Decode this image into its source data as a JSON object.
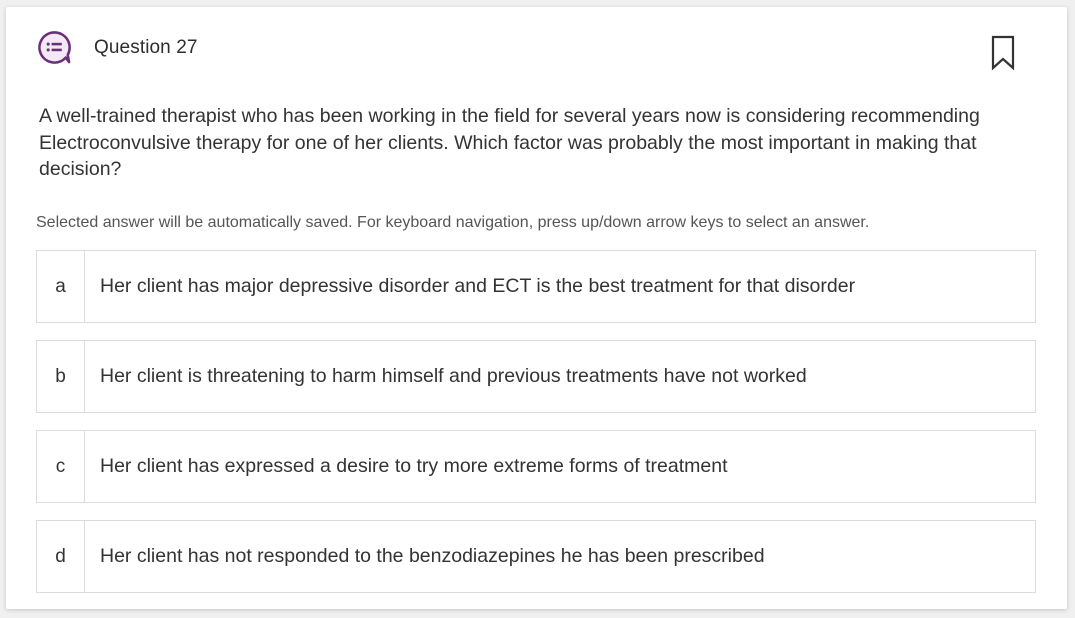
{
  "question": {
    "title": "Question 27",
    "text": "A well-trained therapist who has been working in the field for several years now is considering recommending Electroconvulsive therapy for one of her clients. Which factor was probably the most important in making that decision?",
    "icon": "question-list-icon",
    "bookmark_icon": "bookmark-icon"
  },
  "instructions": "Selected answer will be automatically saved. For keyboard navigation, press up/down arrow keys to select an answer.",
  "answers": [
    {
      "letter": "a",
      "text": "Her client has major depressive disorder and ECT is the best treatment for that disorder"
    },
    {
      "letter": "b",
      "text": "Her client is threatening to harm himself and previous treatments have not worked"
    },
    {
      "letter": "c",
      "text": "Her client has expressed a desire to try more extreme forms of treatment"
    },
    {
      "letter": "d",
      "text": "Her client has not responded to the benzodiazepines he has been prescribed"
    }
  ],
  "colors": {
    "icon_accent": "#6b2f7a",
    "icon_fill": "#f3e9f5",
    "border": "#dcdcdc"
  }
}
